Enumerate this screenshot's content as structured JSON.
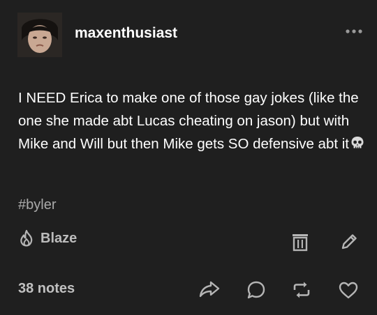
{
  "post": {
    "username": "maxenthusiast",
    "body_text": "I NEED Erica to make one of those gay jokes (like the one she made abt Lucas cheating on jason) but with Mike and Will  but then Mike gets SO defensive abt it",
    "tag": "#byler"
  },
  "actions": {
    "blaze_label": "Blaze",
    "notes_label": "38 notes"
  },
  "icons": {
    "avatar": "avatar",
    "more": "more-icon",
    "skull": "skull-icon",
    "blaze": "flame-icon",
    "delete": "trash-icon",
    "edit": "pencil-icon",
    "share": "share-icon",
    "reply": "reply-icon",
    "reblog": "reblog-icon",
    "like": "heart-icon"
  },
  "colors": {
    "background": "#1f1f1f",
    "text": "#ffffff",
    "muted": "#9a9a9a"
  }
}
